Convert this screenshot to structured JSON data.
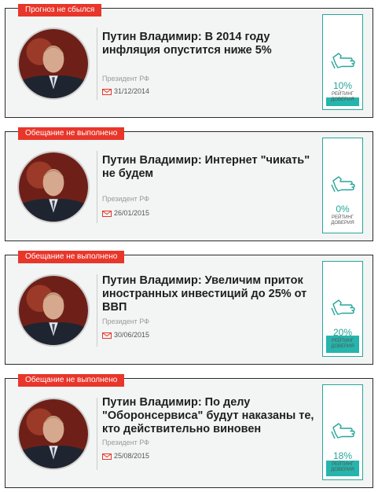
{
  "cards": [
    {
      "tag": "Прогноз не сбылся",
      "title": "Путин Владимир: В 2014 году инфляция опустится ниже 5%",
      "role": "Президент РФ",
      "date": "31/12/2014",
      "rating": {
        "percent": "10%",
        "fill": 0.1,
        "label_line1": "РЕЙТИНГ",
        "label_line2": "ДОВЕРИЯ"
      }
    },
    {
      "tag": "Обещание не выполнено",
      "title": "Путин Владимир: Интернет \"чикать\" не будем",
      "role": "Президент РФ",
      "date": "26/01/2015",
      "rating": {
        "percent": "0%",
        "fill": 0.0,
        "label_line1": "РЕЙТИНГ",
        "label_line2": "ДОВЕРИЯ"
      }
    },
    {
      "tag": "Обещание не выполнено",
      "title": "Путин Владимир: Увеличим приток иностранных инвестиций до 25% от ВВП",
      "role": "Президент РФ",
      "date": "30/06/2015",
      "rating": {
        "percent": "20%",
        "fill": 0.2,
        "label_line1": "РЕЙТИНГ",
        "label_line2": "ДОВЕРИЯ"
      }
    },
    {
      "tag": "Обещание не выполнено",
      "title": "Путин Владимир: По делу \"Оборонсервиса\" будут наказаны те, кто действительно виновен",
      "role": "Президент РФ",
      "date": "25/08/2015",
      "rating": {
        "percent": "18%",
        "fill": 0.18,
        "label_line1": "РЕЙТИНГ",
        "label_line2": "ДОВЕРИЯ"
      }
    }
  ],
  "icons": {
    "date": "calendar-icon",
    "rating": "thumbs-down-hand-icon",
    "avatar": "portrait-photo"
  },
  "colors": {
    "tag": "#e8362a",
    "accent": "#26a69a",
    "rating_fill": "#26b5ad"
  }
}
